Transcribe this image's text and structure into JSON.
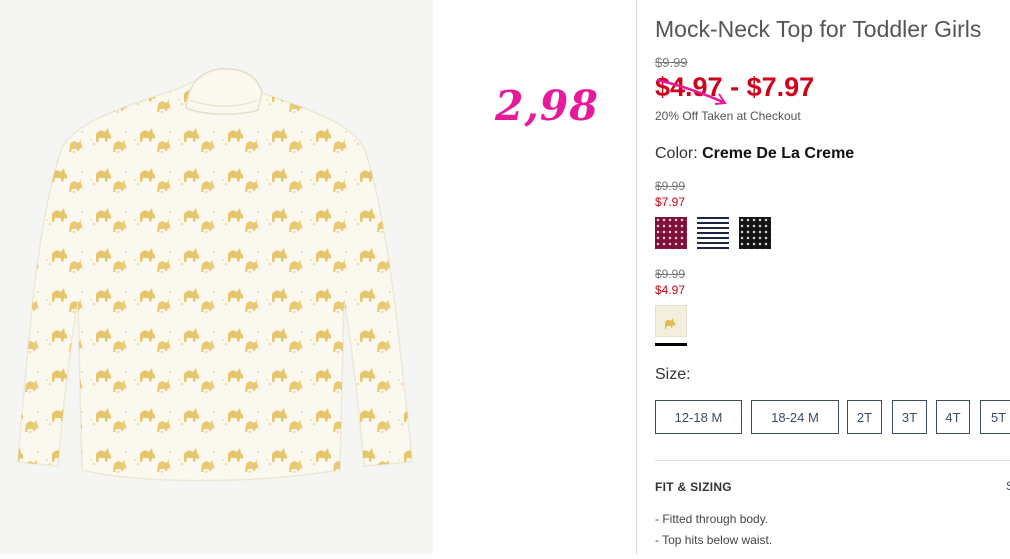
{
  "annotation": "2,98",
  "product": {
    "title": "Mock-Neck Top for Toddler Girls",
    "original_price": "$9.99",
    "sale_price_low": "$4.97",
    "sale_price_sep": " - ",
    "sale_price_high": "$7.97",
    "checkout_note": "20% Off Taken at Checkout"
  },
  "color": {
    "label": "Color: ",
    "selected": "Creme De La Creme",
    "groups": [
      {
        "original_price": "$9.99",
        "sale_price": "$7.97",
        "swatches": [
          {
            "name": "berry-dot",
            "color": "#7d1239"
          },
          {
            "name": "navy-stripe",
            "color": "#1f2547"
          },
          {
            "name": "black-dot",
            "color": "#141414"
          }
        ]
      },
      {
        "original_price": "$9.99",
        "sale_price": "$4.97",
        "swatches": [
          {
            "name": "creme-de-la-creme",
            "color": "#f3efdf",
            "selected": true
          }
        ]
      }
    ]
  },
  "size": {
    "label": "Size:",
    "options": [
      "12-18 M",
      "18-24 M",
      "2T",
      "3T",
      "4T",
      "5T"
    ]
  },
  "fit": {
    "header": "FIT & SIZING",
    "toggle": "S",
    "items": [
      "-  Fitted through body.",
      "-  Top hits below waist."
    ]
  },
  "colors": {
    "sale_red": "#d0021b",
    "annotation_pink": "#e8199a",
    "size_border": "#3a4d63"
  }
}
